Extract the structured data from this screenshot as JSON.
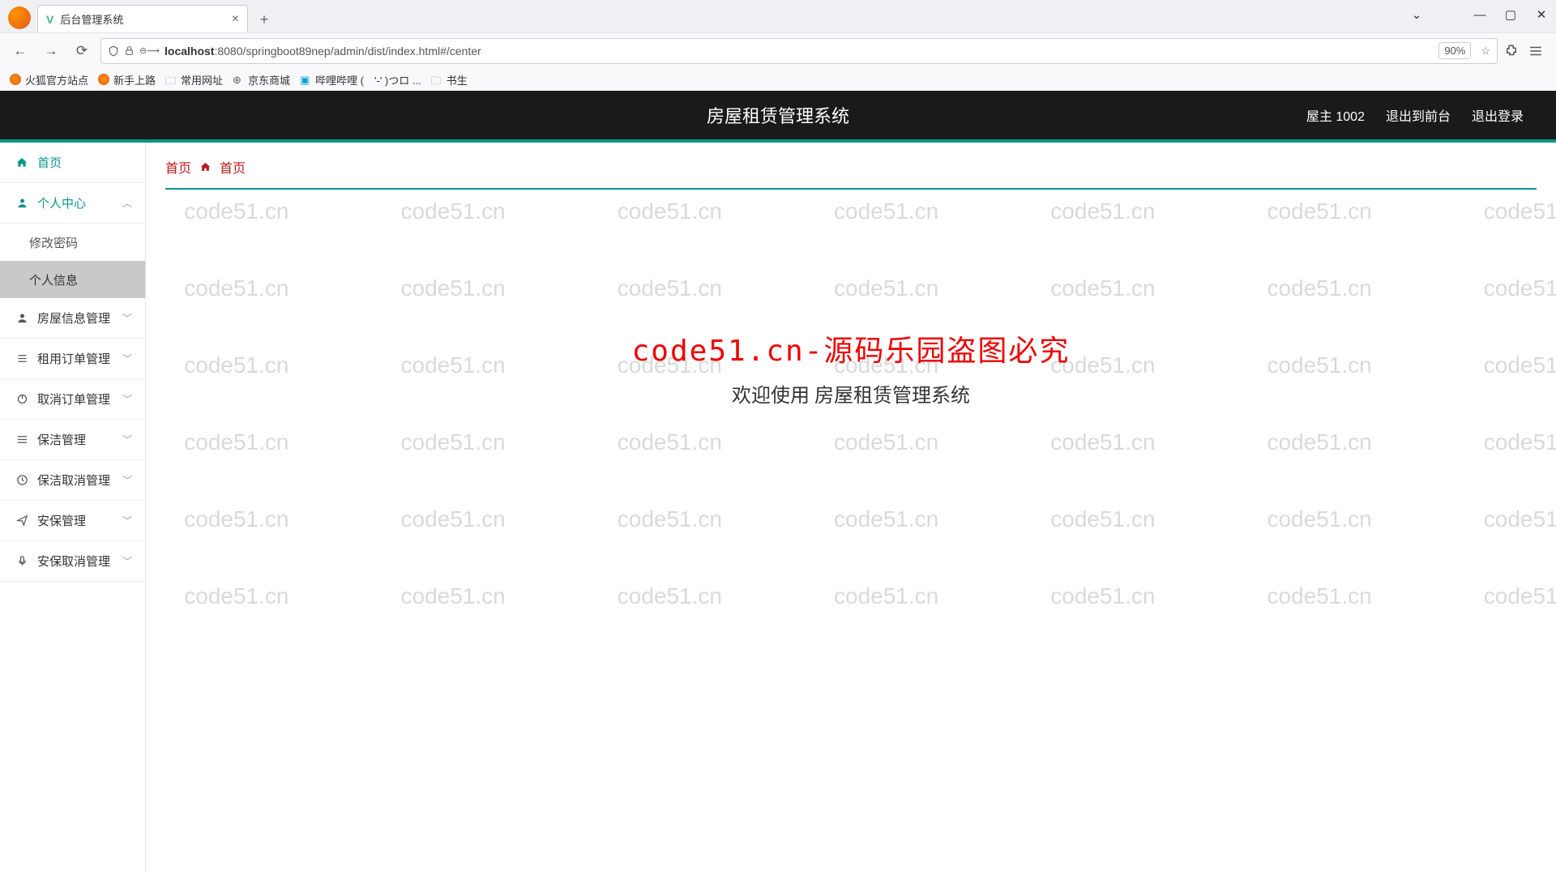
{
  "browser": {
    "tab_title": "后台管理系统",
    "url_display": "localhost:8080/springboot89nep/admin/dist/index.html#/center",
    "url_host": "localhost",
    "zoom": "90%",
    "bookmarks": [
      {
        "label": "火狐官方站点",
        "type": "ff"
      },
      {
        "label": "新手上路",
        "type": "ff"
      },
      {
        "label": "常用网址",
        "type": "folder"
      },
      {
        "label": "京东商城",
        "type": "jd"
      },
      {
        "label": "哔哩哔哩 (　'-' )つロ ...",
        "type": "bili"
      },
      {
        "label": "书生",
        "type": "folder"
      }
    ]
  },
  "header": {
    "title": "房屋租赁管理系统",
    "user_label": "屋主 1002",
    "exit_front": "退出到前台",
    "logout": "退出登录"
  },
  "sidebar": {
    "home": "首页",
    "personal_center": "个人中心",
    "change_password": "修改密码",
    "personal_info": "个人信息",
    "items": [
      {
        "label": "房屋信息管理",
        "icon": "person"
      },
      {
        "label": "租用订单管理",
        "icon": "list"
      },
      {
        "label": "取消订单管理",
        "icon": "power"
      },
      {
        "label": "保洁管理",
        "icon": "menu"
      },
      {
        "label": "保洁取消管理",
        "icon": "clock"
      },
      {
        "label": "安保管理",
        "icon": "send"
      },
      {
        "label": "安保取消管理",
        "icon": "mic"
      }
    ]
  },
  "breadcrumb": {
    "first": "首页",
    "second": "首页"
  },
  "content": {
    "red_banner": "code51.cn-源码乐园盗图必究",
    "welcome": "欢迎使用 房屋租赁管理系统"
  },
  "watermark": "code51.cn"
}
